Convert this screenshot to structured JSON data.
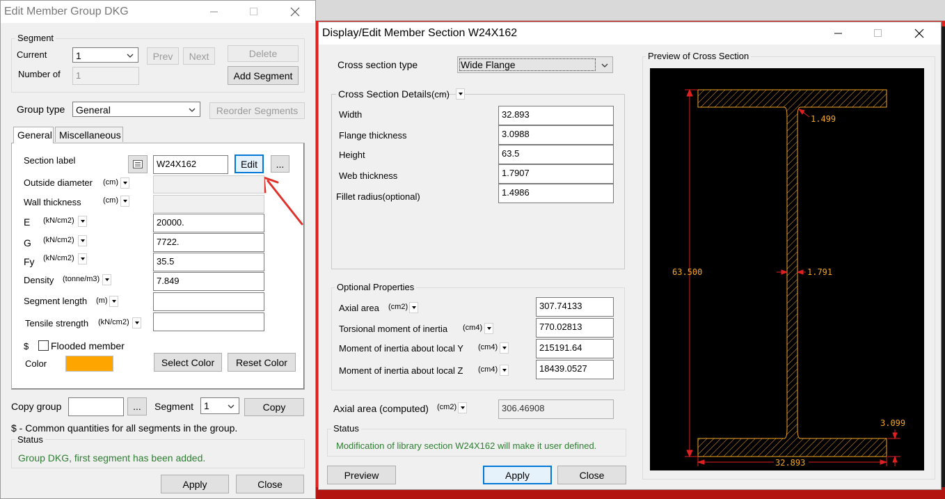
{
  "background": {
    "color": "#1a1a1a",
    "accent_red": "#e0201b"
  },
  "left": {
    "title": "Edit Member Group DKG",
    "segment": {
      "group_label": "Segment",
      "current_label": "Current",
      "current_value": "1",
      "number_label": "Number of",
      "number_value": "1",
      "prev": "Prev",
      "next": "Next",
      "delete": "Delete",
      "add": "Add Segment"
    },
    "group_type_label": "Group type",
    "group_type_value": "General",
    "reorder": "Reorder Segments",
    "tabs": [
      "General",
      "Miscellaneous"
    ],
    "fields": {
      "section_label": "Section label",
      "section_value": "W24X162",
      "edit": "Edit",
      "ellipsis": "...",
      "outside_diameter": "Outside diameter",
      "outside_unit": "(cm)",
      "wall_thickness": "Wall thickness",
      "wall_unit": "(cm)",
      "e_label": "E",
      "e_unit": "(kN/cm2)",
      "e_value": "20000.",
      "g_label": "G",
      "g_unit": "(kN/cm2)",
      "g_value": "7722.",
      "fy_label": "Fy",
      "fy_unit": "(kN/cm2)",
      "fy_value": "35.5",
      "density_label": "Density",
      "density_unit": "(tonne/m3)",
      "density_value": "7.849",
      "seg_length_label": "Segment length",
      "seg_length_unit": "(m)",
      "seg_length_value": "",
      "tensile_label": "Tensile strength",
      "tensile_unit": "(kN/cm2)",
      "tensile_value": "",
      "dollar": "$",
      "flooded": "Flooded member",
      "color_label": "Color",
      "color_value": "#ffa500",
      "select_color": "Select Color",
      "reset_color": "Reset Color"
    },
    "copy_group_label": "Copy group",
    "copy_group_value": "",
    "copy_ellipsis": "...",
    "segment_label": "Segment",
    "segment_value": "1",
    "copy": "Copy",
    "note": "$ - Common quantities for all segments in the group.",
    "status_label": "Status",
    "status_text": "Group DKG, first segment has been added.",
    "apply": "Apply",
    "close": "Close"
  },
  "right": {
    "title": "Display/Edit Member Section W24X162",
    "cs_type_label": "Cross section type",
    "cs_type_value": "Wide Flange",
    "details_label": "Cross Section Details",
    "details_unit": "(cm)",
    "details": [
      {
        "label": "Width",
        "value": "32.893"
      },
      {
        "label": "Flange thickness",
        "value": "3.0988"
      },
      {
        "label": "Height",
        "value": "63.5"
      },
      {
        "label": "Web thickness",
        "value": "1.7907"
      },
      {
        "label": "Fillet radius(optional)",
        "value": "1.4986"
      }
    ],
    "optional_label": "Optional Properties",
    "optional": [
      {
        "label": "Axial area",
        "unit": "(cm2)",
        "value": "307.74133"
      },
      {
        "label": "Torsional moment of inertia",
        "unit": "(cm4)",
        "value": "770.02813"
      },
      {
        "label": "Moment of inertia about local Y",
        "unit": "(cm4)",
        "value": "215191.64"
      },
      {
        "label": "Moment of inertia about local Z",
        "unit": "(cm4)",
        "value": "18439.0527"
      }
    ],
    "computed_label": "Axial area (computed)",
    "computed_unit": "(cm2)",
    "computed_value": "306.46908",
    "status_label": "Status",
    "status_text": "Modification of library section W24X162 will make it user defined.",
    "preview": "Preview",
    "apply": "Apply",
    "close": "Close",
    "preview_label": "Preview of Cross Section",
    "dims": {
      "fillet": "1.499",
      "height": "63.500",
      "web": "1.791",
      "flange": "3.099",
      "width": "32.893"
    }
  }
}
